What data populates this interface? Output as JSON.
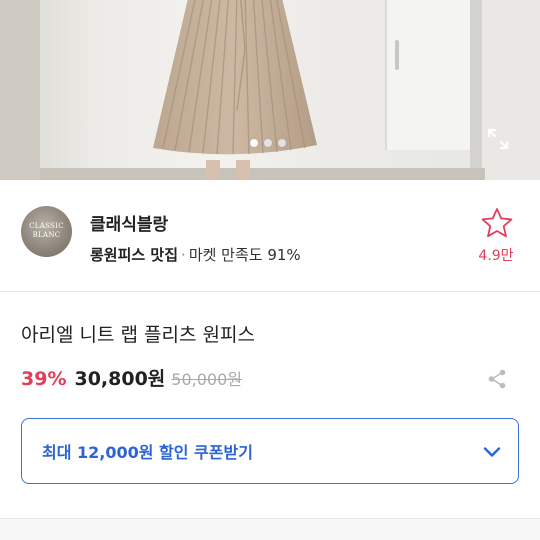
{
  "hero": {
    "image_icon": "product-photo",
    "carousel_total": 3,
    "carousel_active": 1,
    "expand_icon": "expand-icon"
  },
  "seller": {
    "avatar_text": "CLASSIC BLANC",
    "name": "클래식블랑",
    "tag": "롱원피스 맛집",
    "separator": "·",
    "satisfaction": "마켓 만족도 91%",
    "like_count": "4.9만",
    "star_icon": "star-outline-icon"
  },
  "product": {
    "title": "아리엘 니트 랩 플리츠 원피스",
    "discount": "39%",
    "price": "30,800원",
    "original_price": "50,000원",
    "share_icon": "share-icon"
  },
  "coupon": {
    "label": "최대 12,000원 할인 쿠폰받기",
    "chevron_icon": "chevron-down-icon"
  },
  "colors": {
    "accent_red": "#e13e5b",
    "accent_blue": "#2c64d6",
    "coupon_border": "#3a72e0"
  }
}
